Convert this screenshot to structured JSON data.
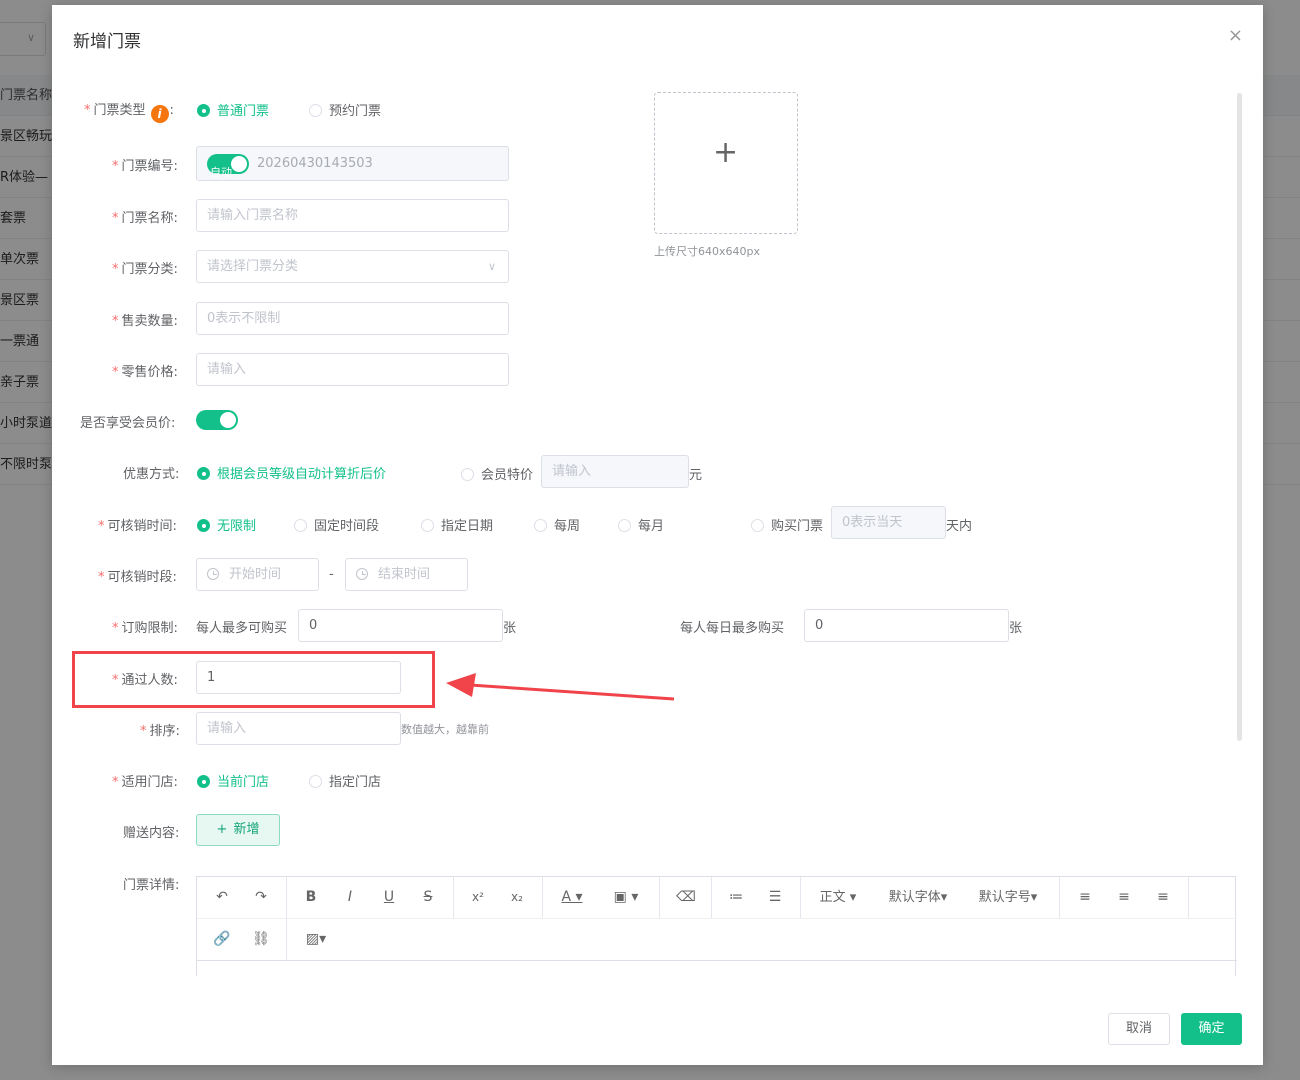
{
  "background": {
    "rows": [
      "门票名称",
      "景区畅玩门",
      "R体验—",
      "套票",
      "单次票",
      "景区票",
      "一票通",
      "亲子票",
      "小时泵道",
      "不限时泵道"
    ]
  },
  "dialog": {
    "title": "新增门票",
    "close": "×",
    "fields": {
      "ticket_type": {
        "label": "门票类型",
        "info": "i",
        "colon": ":",
        "options": [
          "普通门票",
          "预约门票"
        ],
        "selected": 0
      },
      "ticket_no": {
        "label": "门票编号:",
        "switch_text": "自动",
        "value": "20260430143503"
      },
      "ticket_name": {
        "label": "门票名称:",
        "placeholder": "请输入门票名称"
      },
      "ticket_category": {
        "label": "门票分类:",
        "placeholder": "请选择门票分类"
      },
      "sale_qty": {
        "label": "售卖数量:",
        "placeholder": "0表示不限制"
      },
      "retail_price": {
        "label": "零售价格:",
        "placeholder": "请输入"
      },
      "member_price": {
        "label": "是否享受会员价:"
      },
      "discount": {
        "label": "优惠方式:",
        "option1": "根据会员等级自动计算折后价",
        "option2": "会员特价",
        "placeholder": "请输入",
        "unit": "元"
      },
      "verify_time": {
        "label": "可核销时间:",
        "options": [
          "无限制",
          "固定时间段",
          "指定日期",
          "每周",
          "每月",
          "购买门票"
        ],
        "placeholder": "0表示当天",
        "unit": "天内"
      },
      "verify_period": {
        "label": "可核销时段:",
        "start": "开始时间",
        "sep": "-",
        "end": "结束时间"
      },
      "purchase_limit": {
        "label": "订购限制:",
        "per_person": "每人最多可购买",
        "per_value": "0",
        "unit1": "张",
        "per_day": "每人每日最多购买",
        "day_value": "0",
        "unit2": "张"
      },
      "pass_count": {
        "label": "通过人数:",
        "value": "1"
      },
      "sort": {
        "label": "排序:",
        "placeholder": "请输入",
        "tip": "数值越大，越靠前"
      },
      "store": {
        "label": "适用门店:",
        "options": [
          "当前门店",
          "指定门店"
        ],
        "selected": 0
      },
      "gift": {
        "label": "赠送内容:",
        "button": "新增"
      },
      "detail": {
        "label": "门票详情:"
      }
    },
    "upload": {
      "plus": "+",
      "tip": "上传尺寸640x640px"
    },
    "editor": {
      "paragraph": "正文",
      "font": "默认字体",
      "size": "默认字号"
    },
    "buttons": {
      "cancel": "取消",
      "ok": "确定"
    }
  },
  "colors": {
    "accent": "#13c08a",
    "highlight": "#f0444a",
    "info": "#f5750f"
  }
}
